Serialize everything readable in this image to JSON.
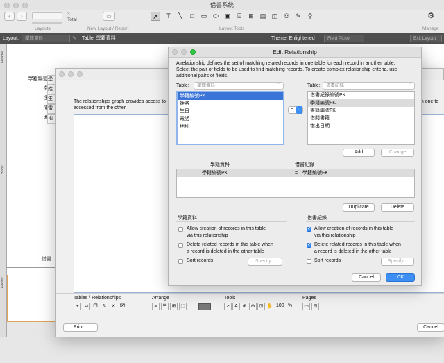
{
  "app": {
    "title": "借書系統"
  },
  "toolbar": {
    "layouts_caption": "Layouts",
    "record_count": "3",
    "record_total": "Total",
    "new_layout_caption": "New Layout / Report",
    "layout_tools_caption": "Layout Tools",
    "manage_caption": "Manage"
  },
  "layout_bar": {
    "layout_label": "Layout:",
    "layout_value": "學籍資料",
    "table_text": "Table: 學籍資料",
    "theme": "Theme: Enlightened",
    "field_picker": "Field Picker",
    "exit_layout": "Exit Layout"
  },
  "parts": {
    "header": "Header",
    "body": "Body",
    "footer": "Footer"
  },
  "layout_fields": {
    "labels": [
      "學籍編號PK",
      "姓名",
      "生日",
      "電話",
      "地址"
    ],
    "values": [
      "學",
      "姓",
      "生",
      "電",
      "地"
    ],
    "bottom_label": "借書"
  },
  "rel_graph": {
    "desc": "The relationships graph provides access to",
    "desc_tail": "on one ta",
    "desc2": "accessed from the other.",
    "tables_label": "Tables / Relationships",
    "arrange_label": "Arrange",
    "tools_label": "Tools",
    "pages_label": "Pages",
    "zoom": "100",
    "zoom_unit": "%",
    "print_label": "Print...",
    "cancel_label": "Cancel"
  },
  "dialog": {
    "title": "Edit Relationship",
    "desc": [
      "A relationship defines the set of matching related records in one table for each record in another table.",
      "Select the pair of fields to be used to find matching records. To create complex relationship criteria, use",
      "additional pairs of fields."
    ],
    "left_table_label": "Table:",
    "left_table_value": "學籍資料",
    "right_table_label": "Table:",
    "right_table_value": "借書紀錄",
    "left_fields": [
      "學籍編號PK",
      "姓名",
      "生日",
      "電話",
      "地址"
    ],
    "right_fields": [
      "借書紀錄編號PK",
      "學籍編號FK",
      "書籍編號FK",
      "借閱書籍",
      "借出日期"
    ],
    "operator": "=",
    "add_label": "Add",
    "change_label": "Change",
    "pairs_header_left": "學籍資料",
    "pairs_header_right": "借書紀錄",
    "pair": {
      "left": "學籍編號PK",
      "op": "=",
      "right": "學籍編號FK"
    },
    "duplicate_label": "Duplicate",
    "delete_label": "Delete",
    "left_opts": {
      "heading": "學籍資料",
      "allow": "Allow creation of records in this table",
      "allow2": "via this relationship",
      "del": "Delete related records in this table when",
      "del2": "a record is deleted in the other table",
      "sort": "Sort records",
      "specify": "Specify..."
    },
    "right_opts": {
      "heading": "借書紀錄",
      "allow": "Allow creation of records in this table",
      "allow2": "via this relationship",
      "del": "Delete related records in this table when",
      "del2": "a record is deleted in the other table",
      "sort": "Sort records",
      "specify": "Specify..."
    },
    "cancel_label": "Cancel",
    "ok_label": "OK"
  },
  "colors": {
    "accent": "#3d8ff3",
    "selection": "#3a74d8"
  }
}
